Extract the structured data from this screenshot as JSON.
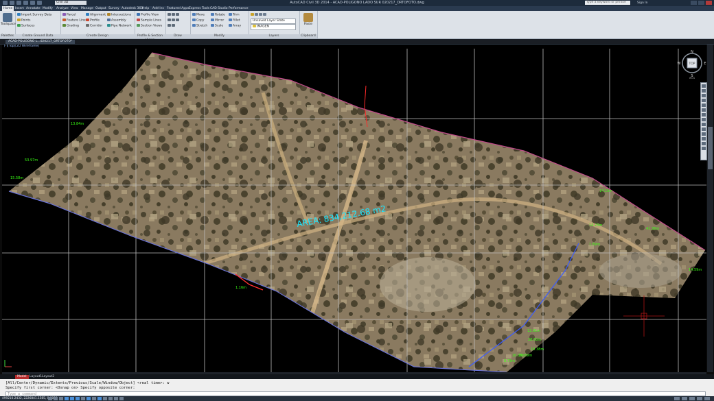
{
  "window": {
    "workspace": "Civil 3D",
    "title": "AutoCAD Civil 3D 2014 - ACAD-POLIGONO LADO SUR 020217_ORTOFOTO.dwg",
    "search_placeholder": "Type a keyword or phrase",
    "sign_in": "Sign In"
  },
  "menu_tabs": [
    "Home",
    "Insert",
    "Annotate",
    "Modify",
    "Analyze",
    "View",
    "Manage",
    "Output",
    "Survey",
    "Autodesk 360",
    "Help",
    "Add-ins",
    "Featured Apps",
    "Express Tools",
    "CAD Studio",
    "Performance"
  ],
  "active_tab": "Home",
  "ribbon": {
    "palettes": {
      "title": "Palettes",
      "big_label": "Toolspace"
    },
    "ground_data": {
      "title": "Create Ground Data",
      "items": [
        "Import Survey Data",
        "Points",
        "Surfaces"
      ]
    },
    "create_design": {
      "title": "Create Design",
      "items": [
        "Parcel",
        "Feature Line",
        "Grading",
        "Alignment",
        "Profile",
        "Corridor",
        "Intersections",
        "Assembly",
        "Pipe Network"
      ]
    },
    "profile_section": {
      "title": "Profile & Section Views",
      "items": [
        "Profile View",
        "Sample Lines",
        "Section Views"
      ]
    },
    "draw": {
      "title": "Draw"
    },
    "modify": {
      "title": "Modify",
      "items": [
        "Move",
        "Copy",
        "Stretch",
        "Rotate",
        "Mirror",
        "Scale",
        "Trim",
        "Fillet",
        "Array"
      ]
    },
    "layers": {
      "title": "Layers",
      "layer_state": "Unsaved Layer State",
      "current_layer": "IMAGEN"
    },
    "clipboard": {
      "title": "Clipboard",
      "big_label": "Paste"
    }
  },
  "document_tab": "ACAD-POLIGONO L...020217_ORTOFOTO*",
  "viewport_label": "[-][Top][2D Wireframe]",
  "drawing": {
    "area_label": "AREA: 834,212.68 m2",
    "dimension_labels": [
      "13.84m",
      "53.97m",
      "15.58m",
      "14.10m",
      "41.36m",
      "14.23m",
      "14.59m",
      "28.60m",
      "12.91m",
      "18.38m",
      "20.09m",
      "21.39m",
      "8.73m",
      "1.16m",
      "1.89m"
    ]
  },
  "nav_cube": {
    "top_label": "TOP",
    "n": "N",
    "s": "S",
    "e": "E",
    "w": "W",
    "wcs": "WCS"
  },
  "layout_tabs": [
    "Model",
    "Layout1",
    "Layout2"
  ],
  "active_layout": "Model",
  "command_history": [
    "[All/Center/Dynamic/Extents/Previous/Scale/Window/Object] <real time>: w",
    "Specify first corner: <Osnap on> Specify opposite corner:"
  ],
  "command_placeholder": "Type a command",
  "status_coords": "499210.2432, 2226841.1585, 0.0000",
  "colors": {
    "title_bg": "#1d2b3c",
    "ribbon_bg": "#dde2e8",
    "dim_text": "#39ff14",
    "area_text": "#19e6ff",
    "grid": "#c8c8c8"
  }
}
